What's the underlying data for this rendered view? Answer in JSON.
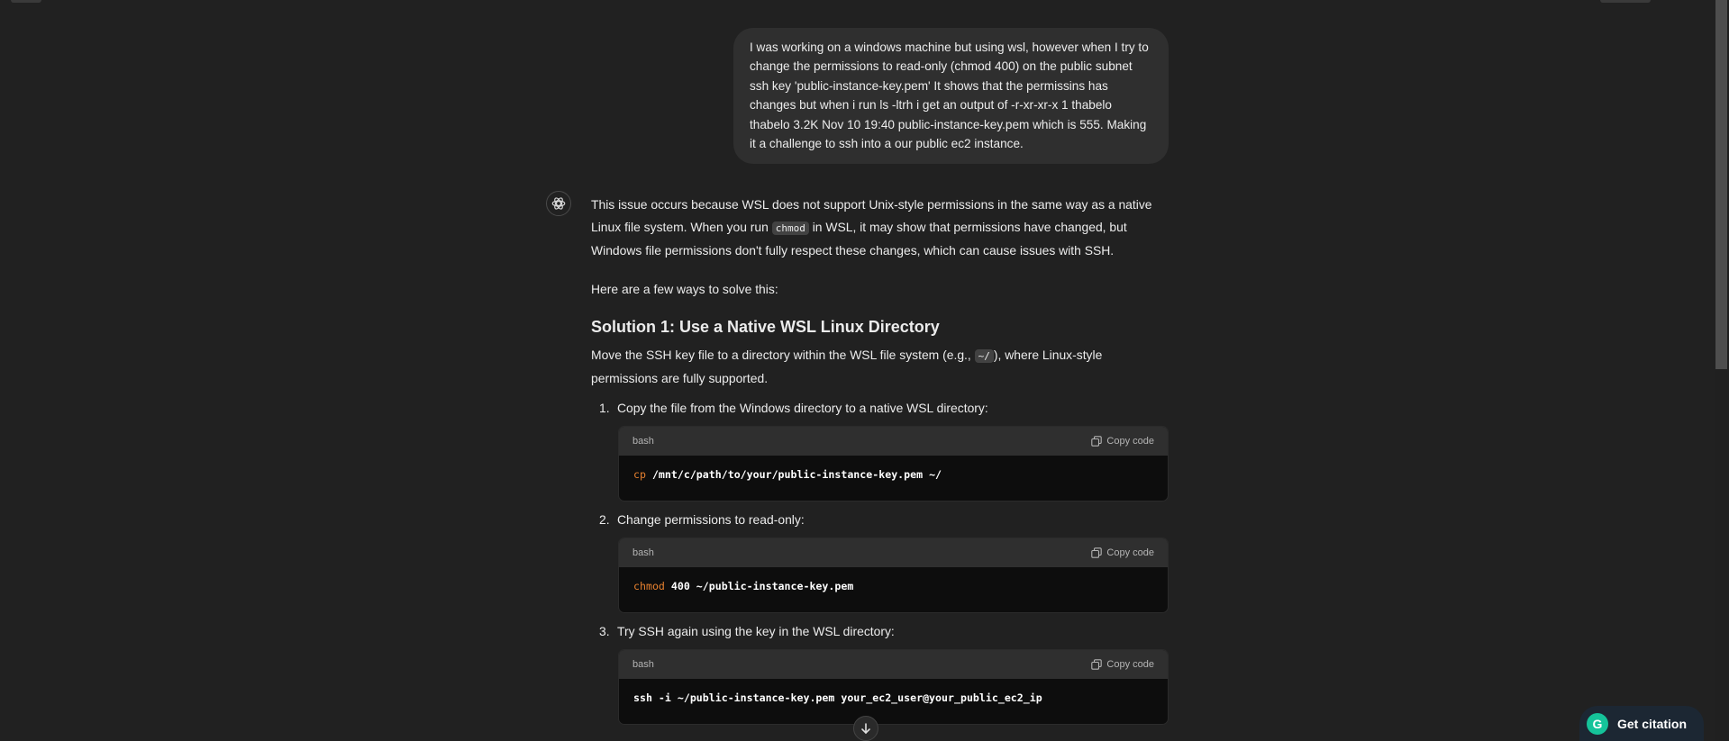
{
  "user_message": "I was working on a windows machine but using wsl, however when I try to change the permissions to read-only (chmod 400) on the public subnet ssh key 'public-instance-key.pem' It shows that the permissins has changes but when i run ls -ltrh i get an output of -r-xr-xr-x 1 thabelo thabelo 3.2K Nov 10 19:40 public-instance-key.pem which is 555. Making it a challenge to ssh into a our public ec2 instance.",
  "assistant": {
    "avatar_icon": "openai-logo-icon",
    "intro": {
      "part1": "This issue occurs because WSL does not support Unix-style permissions in the same way as a native Linux file system. When you run ",
      "code": "chmod",
      "part2": " in WSL, it may show that permissions have changed, but Windows file permissions don't fully respect these changes, which can cause issues with SSH."
    },
    "ways": "Here are a few ways to solve this:",
    "solution1_title": "Solution 1: Use a Native WSL Linux Directory",
    "solution1_desc": {
      "part1": "Move the SSH key file to a directory within the WSL file system (e.g., ",
      "code": "~/",
      "part2": "), where Linux-style permissions are fully supported."
    },
    "steps": [
      {
        "num": "1.",
        "text": "Copy the file from the Windows directory to a native WSL directory:",
        "lang": "bash",
        "copy_label": "Copy code",
        "cmd": "cp",
        "args": " /mnt/c/path/to/your/public-instance-key.pem ~/"
      },
      {
        "num": "2.",
        "text": "Change permissions to read-only:",
        "lang": "bash",
        "copy_label": "Copy code",
        "cmd": "chmod",
        "args": " 400 ~/public-instance-key.pem"
      },
      {
        "num": "3.",
        "text": "Try SSH again using the key in the WSL directory:",
        "lang": "bash",
        "copy_label": "Copy code",
        "cmd": "",
        "args": "ssh -i ~/public-instance-key.pem your_ec2_user@your_public_ec2_ip"
      }
    ]
  },
  "scroll_down_icon": "arrow-down-icon",
  "citation_button": {
    "label": "Get citation",
    "logo_letter": "G"
  },
  "colors": {
    "background": "#212121",
    "bubble": "#2f2f2f",
    "code_bg": "#0d0d0d",
    "keyword": "#e7812f",
    "grammarly": "#15c39a"
  }
}
